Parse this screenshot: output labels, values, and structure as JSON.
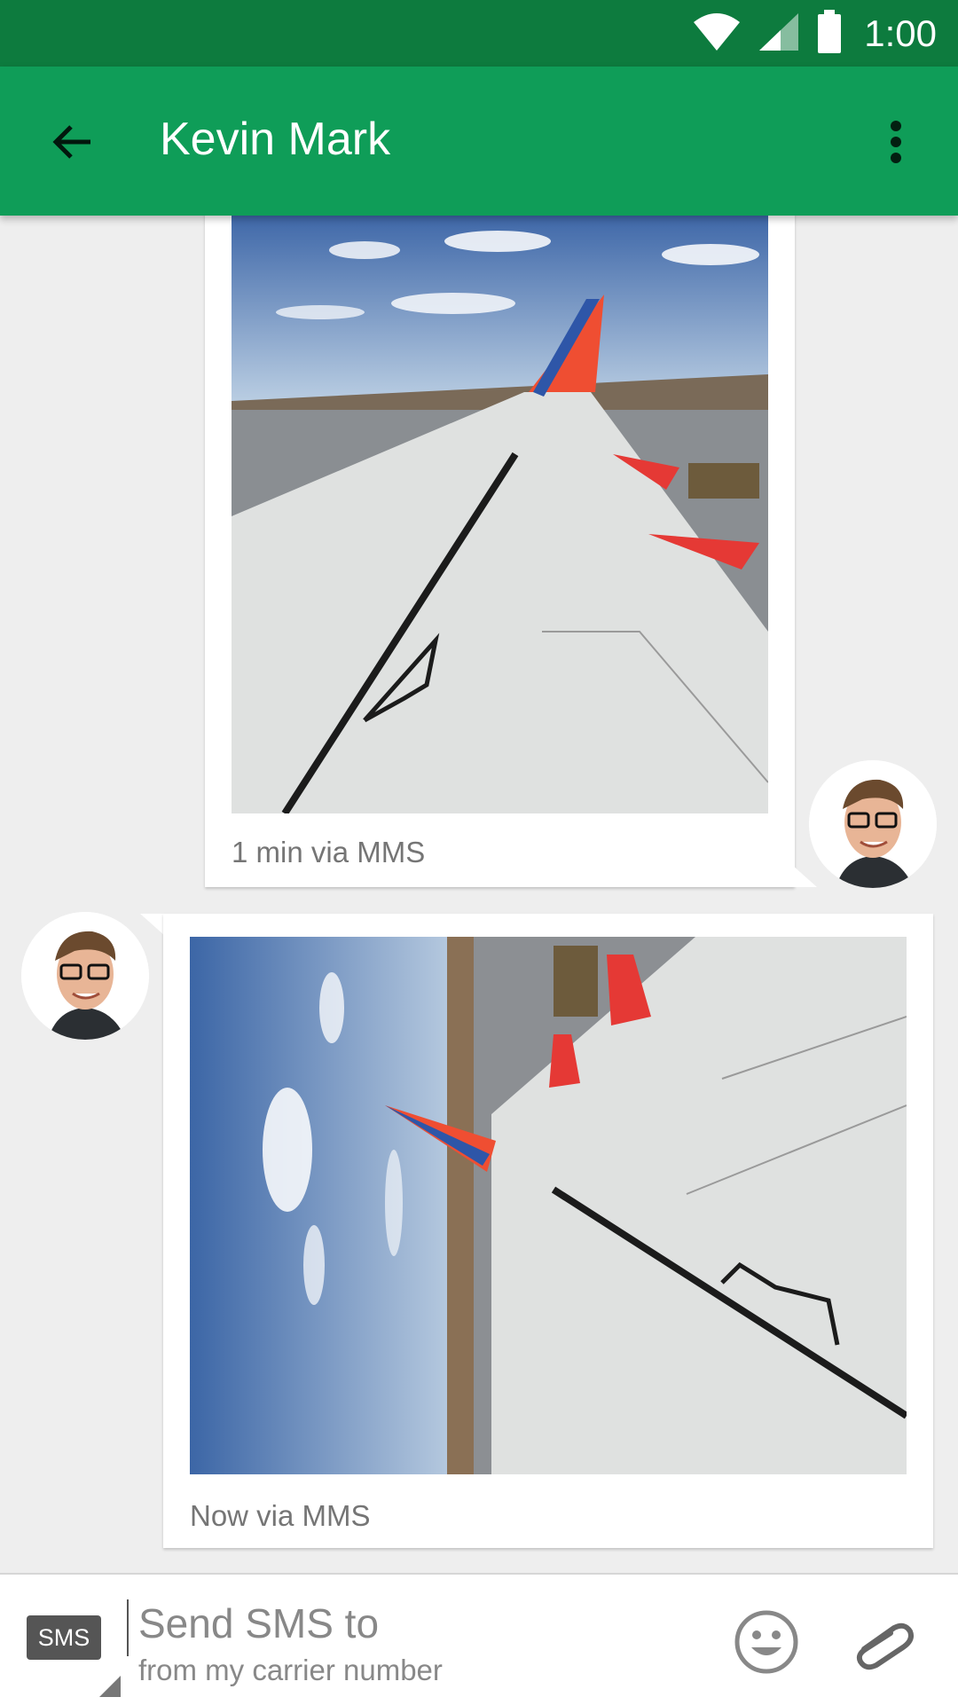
{
  "status_bar": {
    "time": "1:00",
    "icons": [
      "wifi-icon",
      "cell-signal-icon",
      "battery-icon"
    ]
  },
  "app_bar": {
    "title": "Kevin Mark",
    "back_icon": "arrow-back-icon",
    "menu_icon": "more-vert-icon",
    "color": "#0f9d58",
    "status_color": "#0d7b3e"
  },
  "messages": [
    {
      "direction": "outgoing",
      "type": "image",
      "image": "airplane-wing-photo",
      "meta": "1 min via MMS"
    },
    {
      "direction": "incoming",
      "type": "image",
      "image": "airplane-wing-photo-rotated",
      "meta": "Now via MMS"
    }
  ],
  "composer": {
    "mode_badge": "SMS",
    "placeholder_line1": "Send SMS to",
    "placeholder_line2": "from my carrier number",
    "emoji_icon": "emoji-icon",
    "attach_icon": "attachment-icon"
  }
}
